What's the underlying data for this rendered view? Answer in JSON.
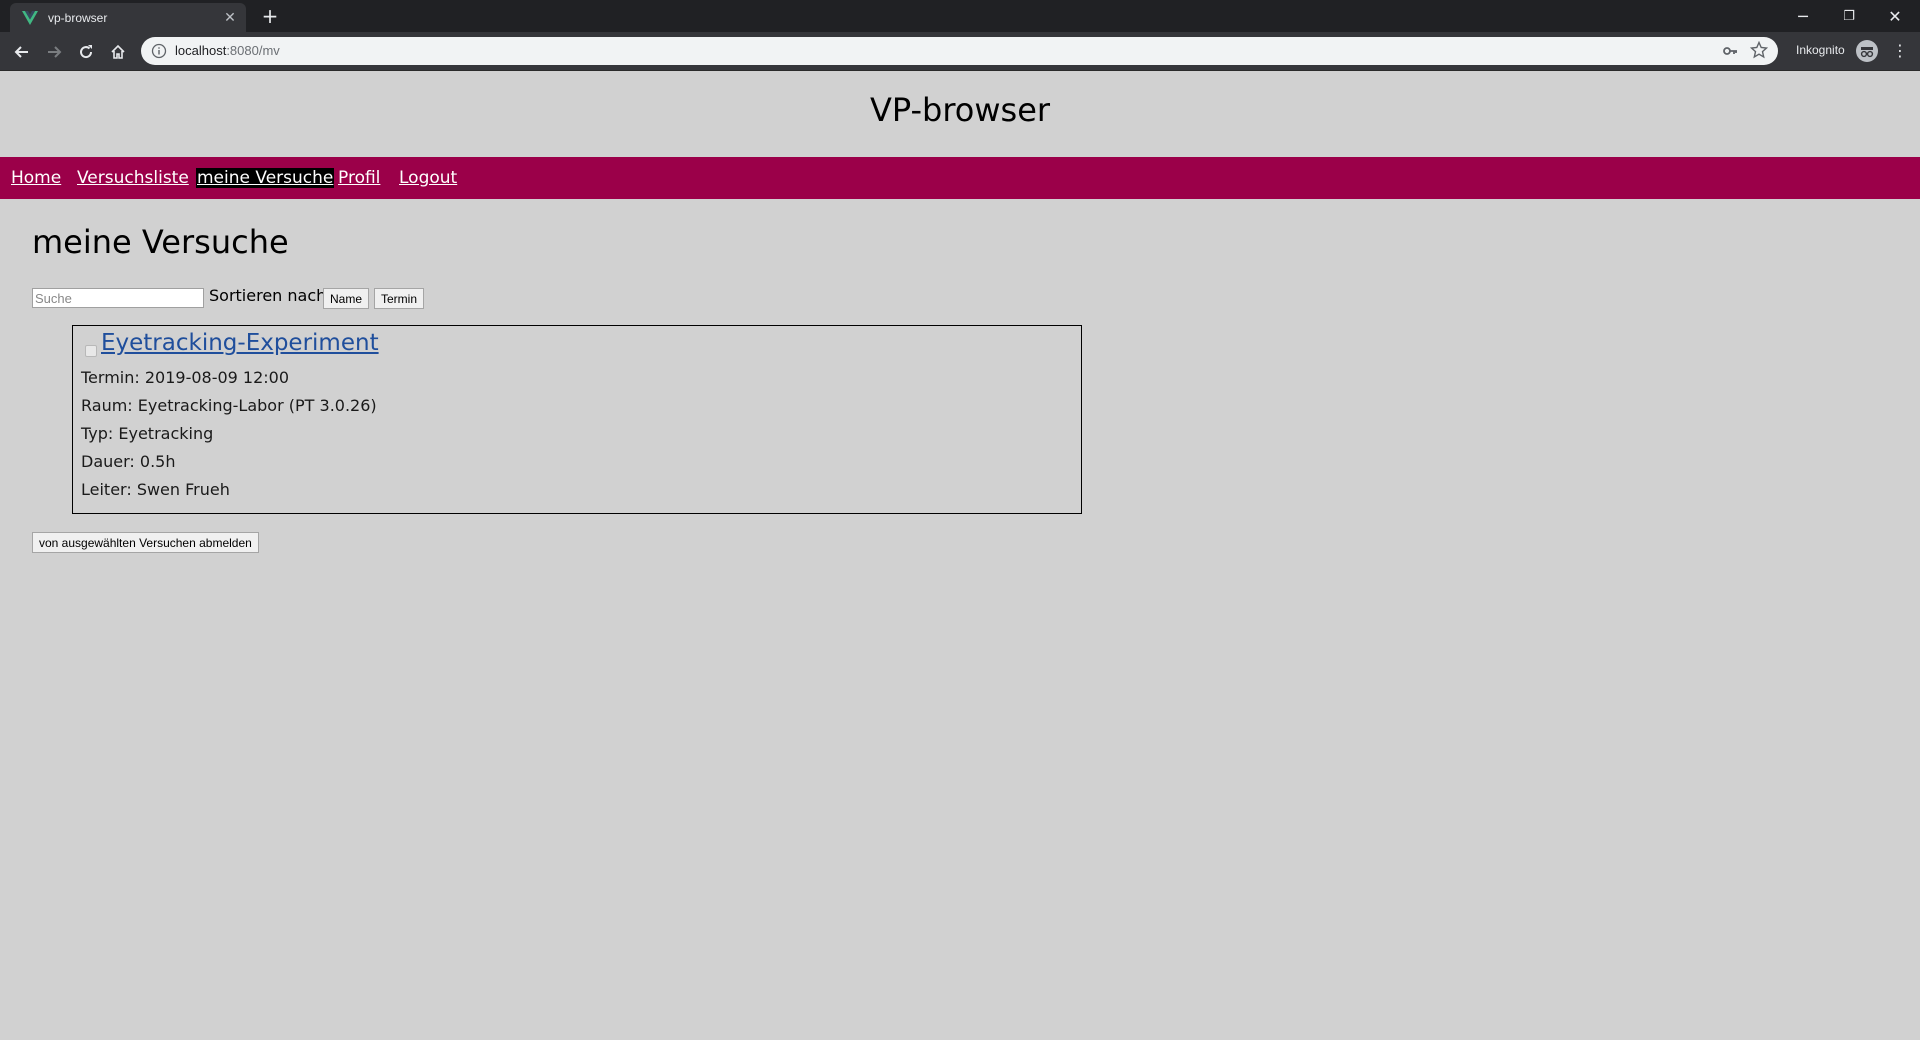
{
  "browser": {
    "tab_title": "vp-browser",
    "tab_close": "✕",
    "new_tab": "+",
    "url_host": "localhost",
    "url_rest": ":8080/mv",
    "incognito_label": "Inkognito",
    "window_controls": {
      "minimize": "─",
      "restore": "❐",
      "close": "✕"
    },
    "menu_glyph": "⋮"
  },
  "site": {
    "title": "VP-browser",
    "nav": {
      "home": "Home",
      "versuchsliste": "Versuchsliste",
      "meine_versuche": "meine Versuche",
      "profil": "Profil",
      "logout": "Logout"
    },
    "active_nav": "meine_versuche",
    "accent_color": "#9b0049"
  },
  "main": {
    "heading": "meine Versuche",
    "search_placeholder": "Suche",
    "sort_label": "Sortieren nach",
    "sort_name": "Name",
    "sort_termin": "Termin",
    "experiments": [
      {
        "title": "Eyetracking-Experiment",
        "checked": false,
        "termin": "Termin: 2019-08-09 12:00",
        "raum": "Raum: Eyetracking-Labor (PT 3.0.26)",
        "typ": "Typ: Eyetracking",
        "dauer": "Dauer: 0.5h",
        "leiter": "Leiter: Swen Frueh"
      }
    ],
    "unregister_button": "von ausgewählten Versuchen abmelden"
  }
}
